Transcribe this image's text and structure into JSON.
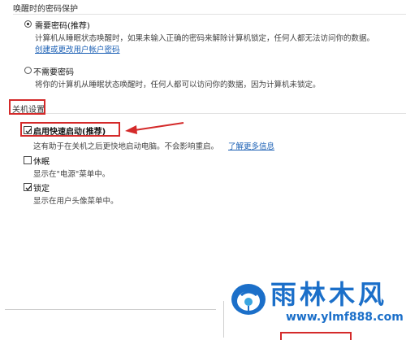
{
  "wake_password": {
    "title": "唤醒时的密码保护",
    "option_require": {
      "label": "需要密码(推荐)",
      "description": "计算机从睡眠状态唤醒时，如果未输入正确的密码来解除计算机锁定，任何人都无法访问你的数据。",
      "link": "创建或更改用户帐户密码",
      "selected": true
    },
    "option_no": {
      "label": "不需要密码",
      "description": "将你的计算机从睡眠状态唤醒时，任何人都可以访问你的数据，因为计算机未锁定。",
      "selected": false
    }
  },
  "shutdown_settings": {
    "title": "关机设置",
    "fast_startup": {
      "label": "启用快速启动(推荐)",
      "description": "这有助于在关机之后更快地启动电脑。不会影响重启。",
      "link": "了解更多信息",
      "checked": true
    },
    "sleep": {
      "label": "休眠",
      "description": "显示在\"电源\"菜单中。",
      "checked": false
    },
    "lock": {
      "label": "锁定",
      "description": "显示在用户头像菜单中。",
      "checked": true
    }
  },
  "watermark": {
    "text": "雨林木风",
    "url": "www.ylmf888.com"
  },
  "colors": {
    "highlight": "#d42a2a",
    "link": "#1a5fb4",
    "logo_blue": "#1b6fc9"
  }
}
